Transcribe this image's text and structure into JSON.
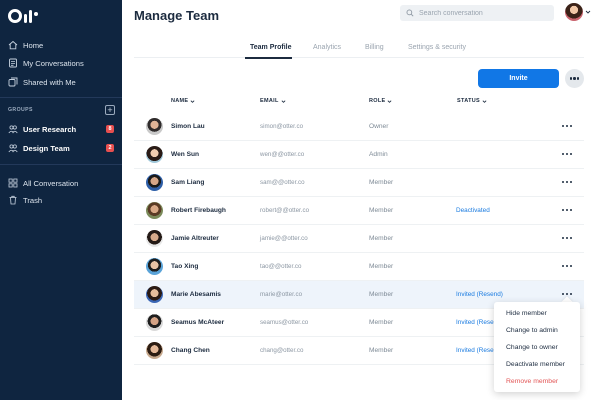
{
  "app": {
    "logo_name": "Otter logo",
    "accent_color": "#1177e6",
    "sidebar_bg": "#0f2540"
  },
  "sidebar": {
    "nav": [
      {
        "label": "Home",
        "icon": "home-icon"
      },
      {
        "label": "My Conversations",
        "icon": "document-icon"
      },
      {
        "label": "Shared with Me",
        "icon": "shared-icon"
      }
    ],
    "groups_label": "GROUPS",
    "add_group_symbol": "+",
    "groups": [
      {
        "label": "User Research",
        "badge": "8",
        "icon": "group-icon"
      },
      {
        "label": "Design Team",
        "badge": "2",
        "icon": "group-icon"
      }
    ],
    "bottom_nav": [
      {
        "label": "All Conversation",
        "icon": "grid-icon"
      },
      {
        "label": "Trash",
        "icon": "trash-icon"
      }
    ]
  },
  "header": {
    "title": "Manage Team",
    "search_placeholder": "Search conversation"
  },
  "tabs": [
    {
      "label": "Team Profile",
      "active": true
    },
    {
      "label": "Analytics",
      "active": false
    },
    {
      "label": "Billing",
      "active": false
    },
    {
      "label": "Settings & security",
      "active": false
    }
  ],
  "actions": {
    "invite_label": "Invite"
  },
  "table": {
    "columns": [
      "NAME",
      "EMAIL",
      "ROLE",
      "STATUS"
    ],
    "rows": [
      {
        "name": "Simon Lau",
        "email": "simon@otter.co",
        "role": "Owner",
        "status": ""
      },
      {
        "name": "Wen Sun",
        "email": "wen@@otter.co",
        "role": "Admin",
        "status": ""
      },
      {
        "name": "Sam Liang",
        "email": "sam@@otter.co",
        "role": "Member",
        "status": ""
      },
      {
        "name": "Robert Firebaugh",
        "email": "robert@@otter.co",
        "role": "Member",
        "status": "Deactivated"
      },
      {
        "name": "Jamie Altreuter",
        "email": "jamie@@otter.co",
        "role": "Member",
        "status": ""
      },
      {
        "name": "Tao Xing",
        "email": "tao@@otter.co",
        "role": "Member",
        "status": ""
      },
      {
        "name": "Marie Abesamis",
        "email": "marie@otter.co",
        "role": "Member",
        "status": "Invited (Resend)"
      },
      {
        "name": "Seamus McAteer",
        "email": "seamus@otter.co",
        "role": "Member",
        "status": "Invited (Rese"
      },
      {
        "name": "Chang Chen",
        "email": "chang@otter.co",
        "role": "Member",
        "status": "Invited (Rese"
      }
    ]
  },
  "context_menu": {
    "items": [
      {
        "label": "Hide member"
      },
      {
        "label": "Change to admin"
      },
      {
        "label": "Change to owner"
      },
      {
        "label": "Deactivate member"
      },
      {
        "label": "Remove member",
        "danger_color": "#e25656"
      }
    ]
  }
}
